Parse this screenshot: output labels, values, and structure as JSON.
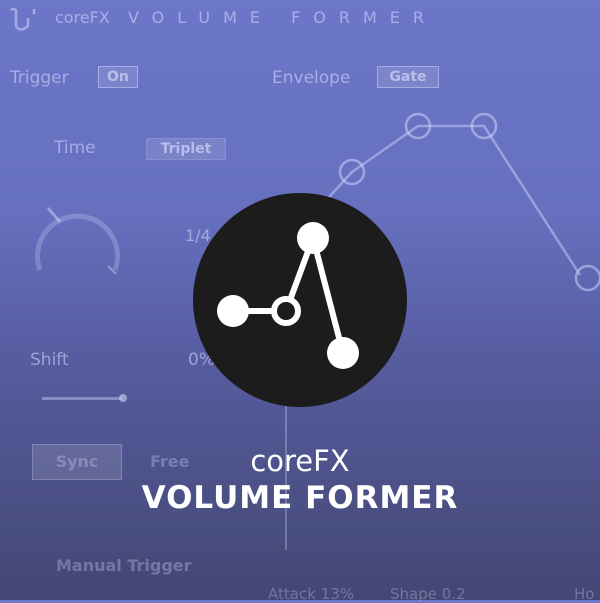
{
  "header": {
    "brand": "coreFX",
    "plugin_title": "VOLUME FORMER",
    "logo_icon": "wave-logo-icon"
  },
  "controls": {
    "trigger_label": "Trigger",
    "trigger_value": "On",
    "envelope_label": "Envelope",
    "envelope_value": "Gate",
    "time_label": "Time",
    "time_value": "Triplet",
    "time_division": "1/4",
    "shift_label": "Shift",
    "shift_value": "0%",
    "sync_label": "Sync",
    "free_label": "Free",
    "manual_trigger_label": "Manual Trigger",
    "attack_label": "Attack",
    "attack_value": "13%",
    "shape_label": "Shape",
    "shape_value": "0.2",
    "hold_label": "Ho"
  },
  "overlay": {
    "brand": "coreFX",
    "product": "VOLUME FORMER",
    "icon": "envelope-nodes-icon"
  },
  "colors": {
    "background_top": "#6d77c9",
    "background_bottom": "#434773",
    "badge": "#1c1c1c"
  }
}
